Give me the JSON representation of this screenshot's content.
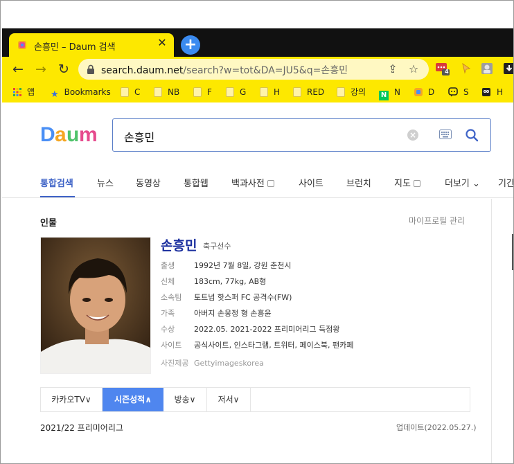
{
  "browser": {
    "tab": {
      "title": "손흥민 – Daum 검색"
    },
    "new_tab_label": "+",
    "url": {
      "host": "search.daum.net",
      "path": "/search?w=tot&DA=JU5&q=손흥민"
    },
    "extension_badge": "4",
    "bookmarks": [
      {
        "label": "앱",
        "icon": "apps-grid-icon"
      },
      {
        "label": "Bookmarks",
        "icon": "star-icon"
      },
      {
        "label": "C",
        "icon": "folder-icon"
      },
      {
        "label": "NB",
        "icon": "folder-icon"
      },
      {
        "label": "F",
        "icon": "folder-icon"
      },
      {
        "label": "G",
        "icon": "folder-icon"
      },
      {
        "label": "H",
        "icon": "folder-icon"
      },
      {
        "label": "RED",
        "icon": "folder-icon"
      },
      {
        "label": "강의",
        "icon": "folder-icon"
      },
      {
        "label": "N",
        "icon": "naver-icon"
      },
      {
        "label": "D",
        "icon": "daum-icon"
      },
      {
        "label": "S",
        "icon": "chat-icon"
      },
      {
        "label": "H",
        "icon": "owl-icon"
      }
    ]
  },
  "search": {
    "query": "손흥민",
    "tabs": [
      {
        "label": "통합검색",
        "active": true,
        "checkbox": false
      },
      {
        "label": "뉴스",
        "active": false,
        "checkbox": false
      },
      {
        "label": "동영상",
        "active": false,
        "checkbox": false
      },
      {
        "label": "통합웹",
        "active": false,
        "checkbox": false
      },
      {
        "label": "백과사전",
        "active": false,
        "checkbox": true
      },
      {
        "label": "사이트",
        "active": false,
        "checkbox": false
      },
      {
        "label": "브런치",
        "active": false,
        "checkbox": false
      },
      {
        "label": "지도",
        "active": false,
        "checkbox": true
      },
      {
        "label": "더보기 ⌄",
        "active": false,
        "checkbox": false
      },
      {
        "label": "기간",
        "active": false,
        "checkbox": false
      }
    ]
  },
  "person": {
    "section_title": "인물",
    "manage_link": "마이프로필 관리",
    "name": "손흥민",
    "job": "축구선수",
    "rows": [
      {
        "key": "출생",
        "value": "1992년 7월 8일, 강원 춘천시"
      },
      {
        "key": "신체",
        "value": "183cm, 77kg, AB형"
      },
      {
        "key": "소속팀",
        "value": "토트넘 핫스퍼 FC 공격수(FW)"
      },
      {
        "key": "가족",
        "value": "아버지 손웅정   형 손흥윤"
      },
      {
        "key": "수상",
        "value": "2022.05. 2021-2022 프리미어리그 득점왕"
      },
      {
        "key": "사이트",
        "value": "공식사이트, 인스타그램, 트위터, 페이스북, 팬카페"
      }
    ],
    "photo_credit_label": "사진제공",
    "photo_credit": "Gettyimageskorea",
    "subtabs": [
      {
        "label": "카카오TV∨",
        "active": false
      },
      {
        "label": "시즌성적∧",
        "active": true
      },
      {
        "label": "방송∨",
        "active": false
      },
      {
        "label": "저서∨",
        "active": false
      }
    ],
    "season_title": "2021/22 프리미어리그",
    "season_updated": "업데이트(2022.05.27.)"
  }
}
